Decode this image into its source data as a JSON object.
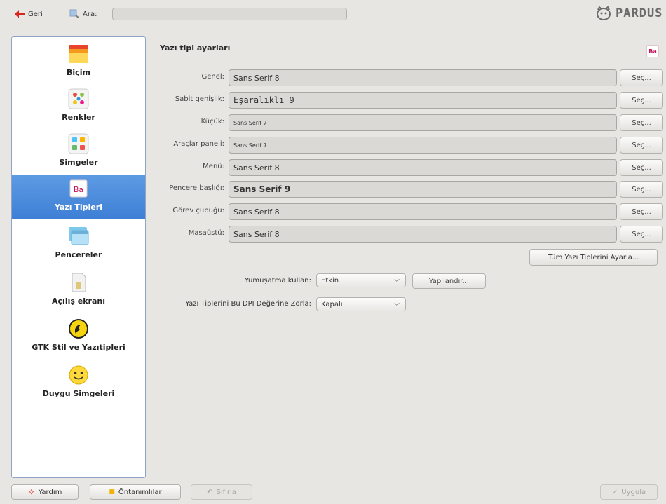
{
  "toolbar": {
    "back_label": "Geri",
    "search_label": "Ara:",
    "search_value": "",
    "logo_text": "PARDUS"
  },
  "sidebar": {
    "items": [
      {
        "label": "Biçim",
        "icon": "format-icon"
      },
      {
        "label": "Renkler",
        "icon": "colors-icon"
      },
      {
        "label": "Simgeler",
        "icon": "icons-icon"
      },
      {
        "label": "Yazı Tipleri",
        "icon": "fonts-icon",
        "active": true
      },
      {
        "label": "Pencereler",
        "icon": "windows-icon"
      },
      {
        "label": "Açılış ekranı",
        "icon": "splash-screen-icon"
      },
      {
        "label": "GTK Stil ve Yazıtipleri",
        "icon": "gtk-icon"
      },
      {
        "label": "Duygu Simgeleri",
        "icon": "emoticons-icon"
      }
    ]
  },
  "main": {
    "title": "Yazı tipi ayarları",
    "font_rows": [
      {
        "label": "Genel:",
        "value": "Sans Serif 8",
        "button": "Seç..."
      },
      {
        "label": "Sabit genişlik:",
        "value": "Eşaralıklı 9",
        "button": "Seç..."
      },
      {
        "label": "Küçük:",
        "value": "Sans Serif 7",
        "button": "Seç..."
      },
      {
        "label": "Araçlar paneli:",
        "value": "Sans Serif 7",
        "button": "Seç..."
      },
      {
        "label": "Menü:",
        "value": "Sans Serif 8",
        "button": "Seç..."
      },
      {
        "label": "Pencere başlığı:",
        "value": "Sans Serif 9",
        "button": "Seç..."
      },
      {
        "label": "Görev çubuğu:",
        "value": "Sans Serif 8",
        "button": "Seç..."
      },
      {
        "label": "Masaüstü:",
        "value": "Sans Serif 8",
        "button": "Seç..."
      }
    ],
    "all_fonts_button": "Tüm Yazı Tiplerini Ayarla...",
    "antialias_label": "Yumuşatma kullan:",
    "antialias_value": "Etkin",
    "configure_button": "Yapılandır...",
    "dpi_label": "Yazı Tiplerini Bu DPI Değerine Zorla:",
    "dpi_value": "Kapalı"
  },
  "bottom": {
    "help_label": "Yardım",
    "defaults_label": "Öntanımlılar",
    "reset_label": "Sıfırla",
    "apply_label": "Uygula"
  },
  "colors": {
    "active_item": "#4a8bdc",
    "background": "#e8e6e3"
  }
}
